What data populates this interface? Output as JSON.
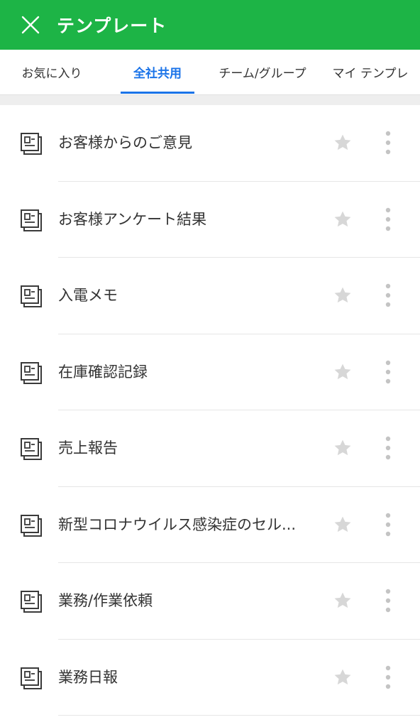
{
  "header": {
    "title": "テンプレート",
    "close_icon": "close-icon",
    "background_color": "#1db446"
  },
  "tabs": [
    {
      "label": "お気に入り",
      "active": false
    },
    {
      "label": "全社共用",
      "active": true
    },
    {
      "label": "チーム/グループ",
      "active": false
    },
    {
      "label": "マイ テンプレ",
      "active": false
    }
  ],
  "accent_color": "#1a73e8",
  "templates": [
    {
      "title": "お客様からのご意見",
      "icon": "document-icon",
      "starred": false
    },
    {
      "title": "お客様アンケート結果",
      "icon": "document-icon",
      "starred": false
    },
    {
      "title": "入電メモ",
      "icon": "document-icon",
      "starred": false
    },
    {
      "title": "在庫確認記録",
      "icon": "document-icon",
      "starred": false
    },
    {
      "title": "売上報告",
      "icon": "document-icon",
      "starred": false
    },
    {
      "title": "新型コロナウイルス感染症のセル...",
      "icon": "document-icon",
      "starred": false
    },
    {
      "title": "業務/作業依頼",
      "icon": "document-icon",
      "starred": false
    },
    {
      "title": "業務日報",
      "icon": "document-icon",
      "starred": false
    }
  ]
}
